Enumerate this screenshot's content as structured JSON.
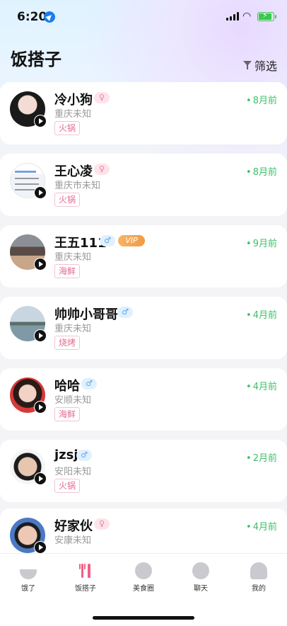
{
  "status_bar": {
    "time": "6:20"
  },
  "header": {
    "title": "饭搭子",
    "filter_label": "筛选"
  },
  "users": [
    {
      "name": "冷小狗",
      "gender": "female",
      "gender_symbol": "♀",
      "location": "重庆未知",
      "tag": "火锅",
      "time_ago": "8月前",
      "vip": ""
    },
    {
      "name": "王心凌",
      "gender": "female",
      "gender_symbol": "♀",
      "location": "重庆市未知",
      "tag": "火锅",
      "time_ago": "8月前",
      "vip": ""
    },
    {
      "name": "王五111",
      "gender": "male",
      "gender_symbol": "♂",
      "location": "重庆未知",
      "tag": "海鲜",
      "time_ago": "9月前",
      "vip": "VIP"
    },
    {
      "name": "帅帅小哥哥",
      "gender": "male",
      "gender_symbol": "♂",
      "location": "重庆未知",
      "tag": "烧烤",
      "time_ago": "4月前",
      "vip": ""
    },
    {
      "name": "哈哈",
      "gender": "male",
      "gender_symbol": "♂",
      "location": "安顺未知",
      "tag": "海鲜",
      "time_ago": "4月前",
      "vip": ""
    },
    {
      "name": "jzsj",
      "gender": "male",
      "gender_symbol": "♂",
      "location": "安阳未知",
      "tag": "火锅",
      "time_ago": "2月前",
      "vip": ""
    },
    {
      "name": "好家伙",
      "gender": "female",
      "gender_symbol": "♀",
      "location": "安康未知",
      "tag": "",
      "time_ago": "4月前",
      "vip": ""
    }
  ],
  "tab_bar": {
    "tabs": [
      {
        "label": "饿了",
        "icon": "bowl-icon"
      },
      {
        "label": "饭搭子",
        "icon": "fork-knife-icon",
        "active": true
      },
      {
        "label": "美食圈",
        "icon": "food-circle-icon"
      },
      {
        "label": "聊天",
        "icon": "chat-icon"
      },
      {
        "label": "我的",
        "icon": "profile-icon"
      }
    ]
  },
  "colors": {
    "accent_green": "#3fbf6a",
    "tag_pink": "#e26b8e",
    "active_tab": "#f05f86"
  }
}
